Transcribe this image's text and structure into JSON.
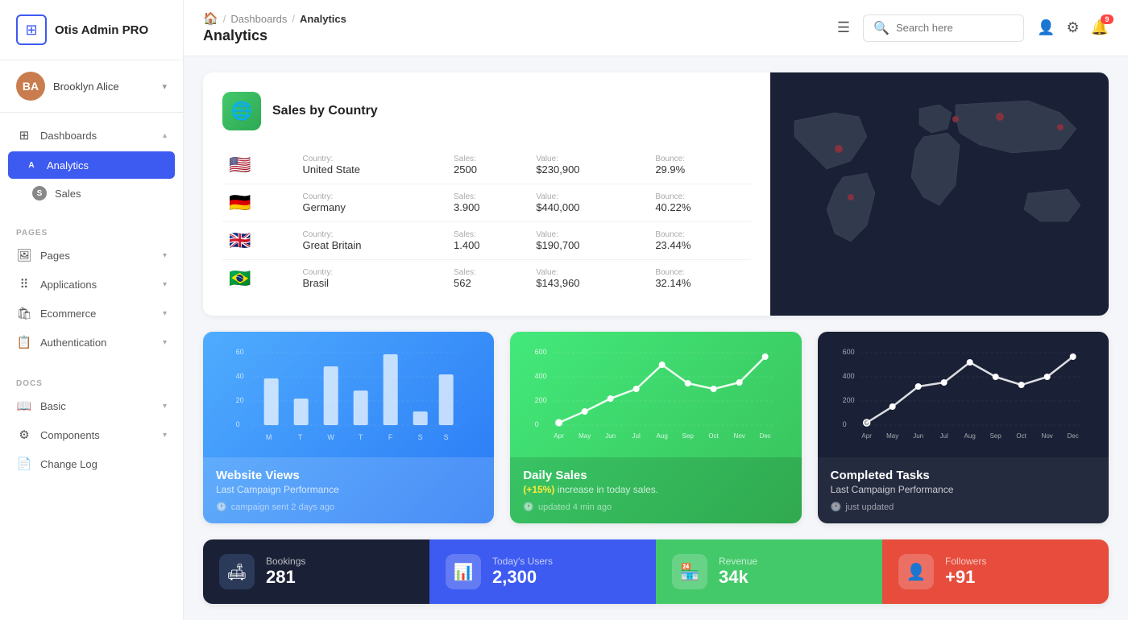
{
  "app": {
    "name": "Otis Admin PRO"
  },
  "user": {
    "name": "Brooklyn Alice",
    "initials": "BA"
  },
  "sidebar": {
    "sections": [
      {
        "label": "",
        "items": [
          {
            "id": "dashboards",
            "label": "Dashboards",
            "icon": "⊞",
            "hasArrow": true,
            "active": false,
            "subitems": [
              {
                "id": "analytics",
                "label": "Analytics",
                "icon": "A",
                "active": true
              },
              {
                "id": "sales",
                "label": "Sales",
                "icon": "S",
                "active": false
              }
            ]
          }
        ]
      },
      {
        "label": "PAGES",
        "items": [
          {
            "id": "pages",
            "label": "Pages",
            "icon": "🖼",
            "hasArrow": true
          },
          {
            "id": "applications",
            "label": "Applications",
            "icon": "⠿",
            "hasArrow": true
          },
          {
            "id": "ecommerce",
            "label": "Ecommerce",
            "icon": "🛍",
            "hasArrow": true
          },
          {
            "id": "authentication",
            "label": "Authentication",
            "icon": "📋",
            "hasArrow": true
          }
        ]
      },
      {
        "label": "DOCS",
        "items": [
          {
            "id": "basic",
            "label": "Basic",
            "icon": "📖",
            "hasArrow": true
          },
          {
            "id": "components",
            "label": "Components",
            "icon": "⚙",
            "hasArrow": true
          },
          {
            "id": "changelog",
            "label": "Change Log",
            "icon": "📄"
          }
        ]
      }
    ]
  },
  "topbar": {
    "breadcrumb": [
      "🏠",
      "Dashboards",
      "Analytics"
    ],
    "page_title": "Analytics",
    "hamburger_label": "☰",
    "search_placeholder": "Search here",
    "notification_count": "9"
  },
  "sales_by_country": {
    "title": "Sales by Country",
    "icon": "🌐",
    "countries": [
      {
        "flag": "🇺🇸",
        "country_label": "Country:",
        "country": "United State",
        "sales_label": "Sales:",
        "sales": "2500",
        "value_label": "Value:",
        "value": "$230,900",
        "bounce_label": "Bounce:",
        "bounce": "29.9%"
      },
      {
        "flag": "🇩🇪",
        "country_label": "Country:",
        "country": "Germany",
        "sales_label": "Sales:",
        "sales": "3.900",
        "value_label": "Value:",
        "value": "$440,000",
        "bounce_label": "Bounce:",
        "bounce": "40.22%"
      },
      {
        "flag": "🇬🇧",
        "country_label": "Country:",
        "country": "Great Britain",
        "sales_label": "Sales:",
        "sales": "1.400",
        "value_label": "Value:",
        "value": "$190,700",
        "bounce_label": "Bounce:",
        "bounce": "23.44%"
      },
      {
        "flag": "🇧🇷",
        "country_label": "Country:",
        "country": "Brasil",
        "sales_label": "Sales:",
        "sales": "562",
        "value_label": "Value:",
        "value": "$143,960",
        "bounce_label": "Bounce:",
        "bounce": "32.14%"
      }
    ]
  },
  "website_views": {
    "title": "Website Views",
    "subtitle": "Last Campaign Performance",
    "time_label": "campaign sent 2 days ago",
    "y_labels": [
      "60",
      "40",
      "20",
      "0"
    ],
    "x_labels": [
      "M",
      "T",
      "W",
      "T",
      "F",
      "S",
      "S"
    ],
    "bars": [
      35,
      20,
      45,
      25,
      55,
      10,
      40
    ]
  },
  "daily_sales": {
    "title": "Daily Sales",
    "subtitle_prefix": "(+15%)",
    "subtitle_suffix": " increase in today sales.",
    "time_label": "updated 4 min ago",
    "y_labels": [
      "600",
      "400",
      "200",
      "0"
    ],
    "x_labels": [
      "Apr",
      "May",
      "Jun",
      "Jul",
      "Aug",
      "Sep",
      "Oct",
      "Nov",
      "Dec"
    ],
    "values": [
      20,
      80,
      200,
      300,
      480,
      320,
      260,
      320,
      500
    ]
  },
  "completed_tasks": {
    "title": "Completed Tasks",
    "subtitle": "Last Campaign Performance",
    "time_label": "just updated",
    "y_labels": [
      "600",
      "400",
      "200",
      "0"
    ],
    "x_labels": [
      "Apr",
      "May",
      "Jun",
      "Jul",
      "Aug",
      "Sep",
      "Oct",
      "Nov",
      "Dec"
    ],
    "values": [
      20,
      120,
      280,
      320,
      460,
      350,
      300,
      360,
      500
    ]
  },
  "stats": [
    {
      "id": "bookings",
      "icon": "🛋",
      "label": "Bookings",
      "value": "281",
      "theme": "dark"
    },
    {
      "id": "today_users",
      "icon": "📊",
      "label": "Today's Users",
      "value": "2,300",
      "theme": "blue"
    },
    {
      "id": "revenue",
      "icon": "🏪",
      "label": "Revenue",
      "value": "34k",
      "theme": "green"
    },
    {
      "id": "followers",
      "icon": "👤",
      "label": "Followers",
      "value": "+91",
      "theme": "red"
    }
  ],
  "colors": {
    "blue": "#3d5af1",
    "green": "#43c96a",
    "dark": "#1a2035",
    "red": "#e74c3c",
    "accent_yellow": "#ffeb3b"
  }
}
